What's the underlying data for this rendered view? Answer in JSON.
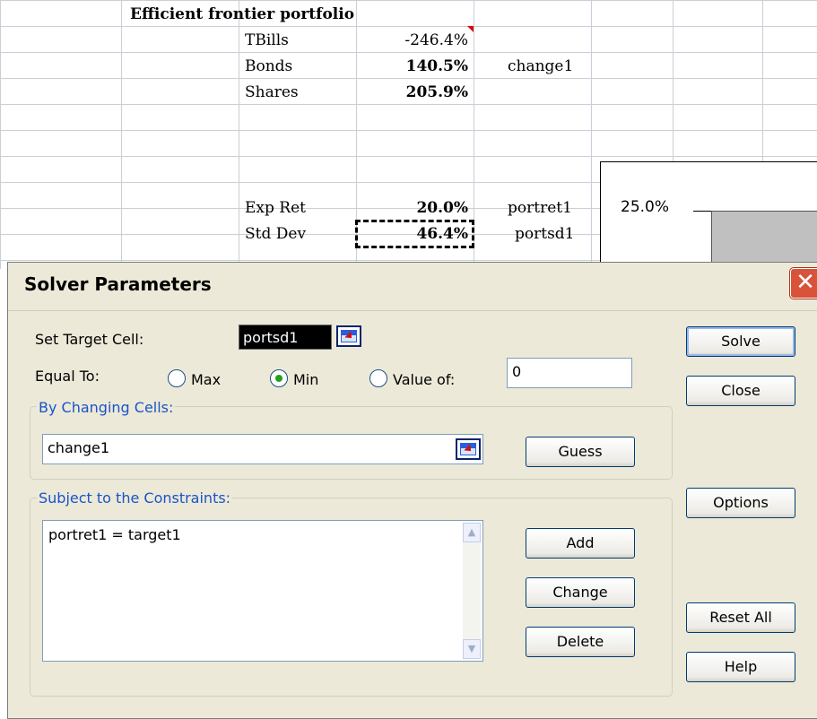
{
  "sheet": {
    "heading": "Efficient frontier portfolio",
    "rows": [
      {
        "label": "TBills",
        "value": "-246.4%",
        "name": ""
      },
      {
        "label": "Bonds",
        "value": "140.5%",
        "name": "change1"
      },
      {
        "label": "Shares",
        "value": "205.9%",
        "name": ""
      },
      {
        "label": "Exp Ret",
        "value": "20.0%",
        "name": "portret1"
      },
      {
        "label": "Std Dev",
        "value": "46.4%",
        "name": "portsd1"
      }
    ],
    "chart_axis_label": "25.0%"
  },
  "dialog": {
    "title": "Solver Parameters",
    "set_target_label": "Set Target Cell:",
    "target_value": "portsd1",
    "equal_to_label": "Equal To:",
    "options": {
      "max": "Max",
      "min": "Min",
      "value_of": "Value of:",
      "selected": "Min"
    },
    "value_of_input": "0",
    "changing_cells_label": "By Changing Cells:",
    "changing_cells_value": "change1",
    "constraints_label": "Subject to the Constraints:",
    "constraints": [
      "portret1 = target1"
    ],
    "buttons": {
      "solve": "Solve",
      "close": "Close",
      "options": "Options",
      "reset_all": "Reset All",
      "help": "Help",
      "guess": "Guess",
      "add": "Add",
      "change": "Change",
      "delete": "Delete"
    }
  }
}
